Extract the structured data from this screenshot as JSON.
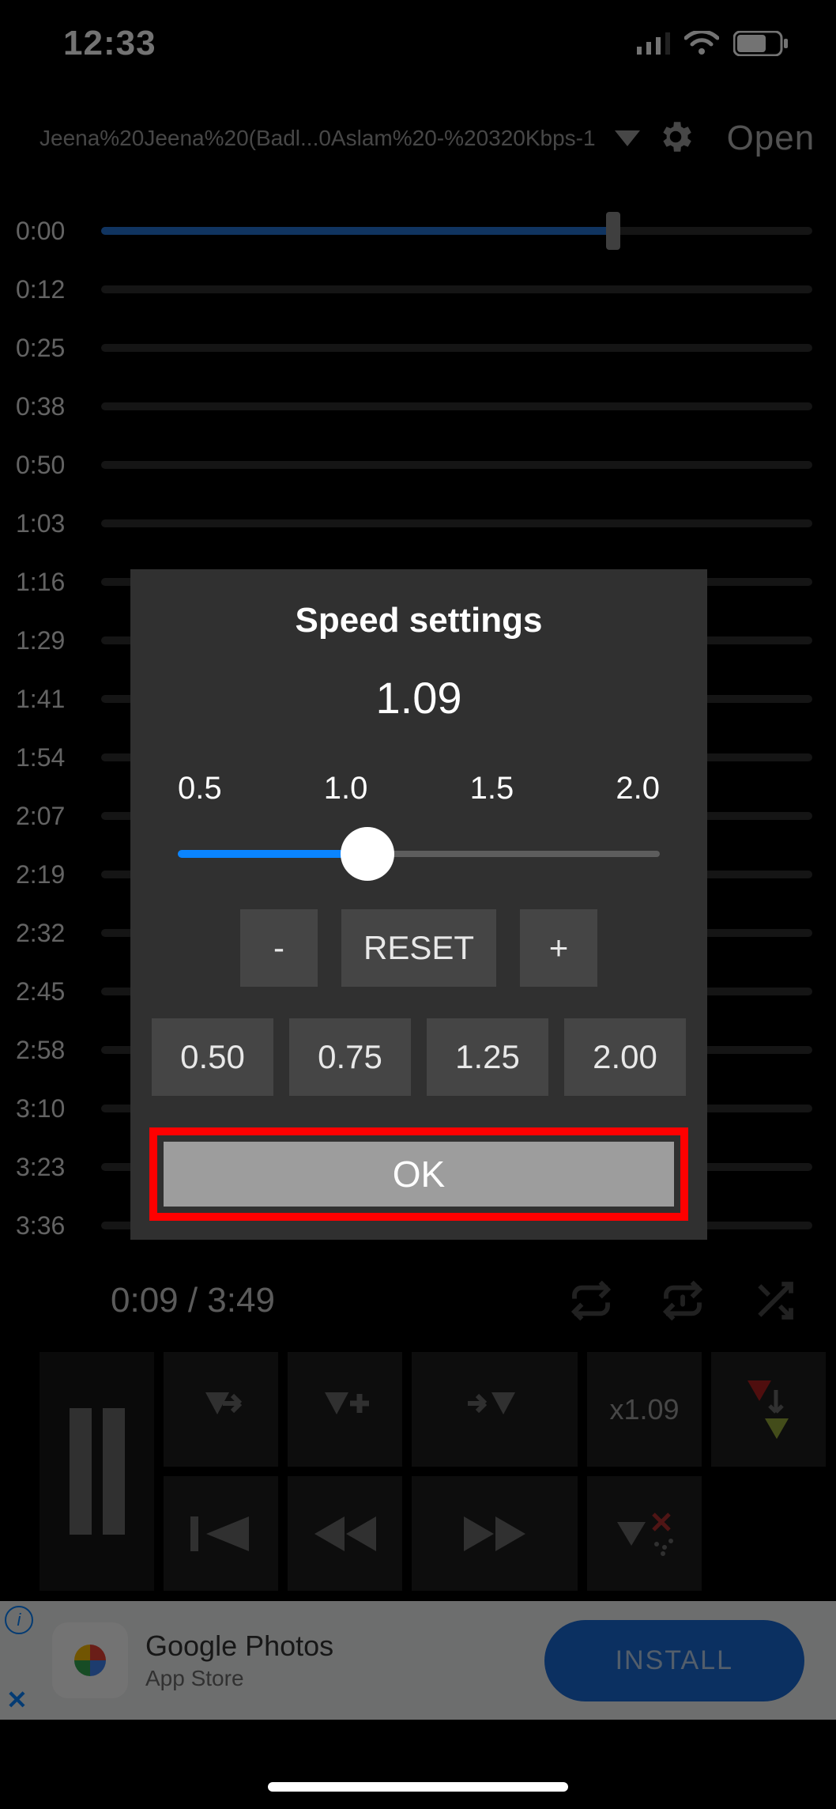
{
  "statusbar": {
    "time": "12:33"
  },
  "header": {
    "track_title": "Jeena%20Jeena%20(Badl...0Aslam%20-%20320Kbps-1",
    "open_label": "Open"
  },
  "timeline": {
    "rows": [
      {
        "label": "0:00",
        "progress": 0.72
      },
      {
        "label": "0:12",
        "progress": 0
      },
      {
        "label": "0:25",
        "progress": 0
      },
      {
        "label": "0:38",
        "progress": 0
      },
      {
        "label": "0:50",
        "progress": 0
      },
      {
        "label": "1:03",
        "progress": 0
      },
      {
        "label": "1:16",
        "progress": 0
      },
      {
        "label": "1:29",
        "progress": 0
      },
      {
        "label": "1:41",
        "progress": 0
      },
      {
        "label": "1:54",
        "progress": 0
      },
      {
        "label": "2:07",
        "progress": 0
      },
      {
        "label": "2:19",
        "progress": 0
      },
      {
        "label": "2:32",
        "progress": 0
      },
      {
        "label": "2:45",
        "progress": 0
      },
      {
        "label": "2:58",
        "progress": 0
      },
      {
        "label": "3:10",
        "progress": 0
      },
      {
        "label": "3:23",
        "progress": 0
      },
      {
        "label": "3:36",
        "progress": 0
      }
    ]
  },
  "player": {
    "position_label": "0:09 / 3:49",
    "speed_display": "x1.09"
  },
  "ad": {
    "title": "Google Photos",
    "subtitle": "App Store",
    "cta": "INSTALL"
  },
  "dialog": {
    "title": "Speed settings",
    "value": "1.09",
    "ticks": [
      "0.5",
      "1.0",
      "1.5",
      "2.0"
    ],
    "slider_min": 0.5,
    "slider_max": 2.0,
    "slider_value": 1.09,
    "minus": "-",
    "reset": "RESET",
    "plus": "+",
    "presets": [
      "0.50",
      "0.75",
      "1.25",
      "2.00"
    ],
    "ok": "OK"
  }
}
